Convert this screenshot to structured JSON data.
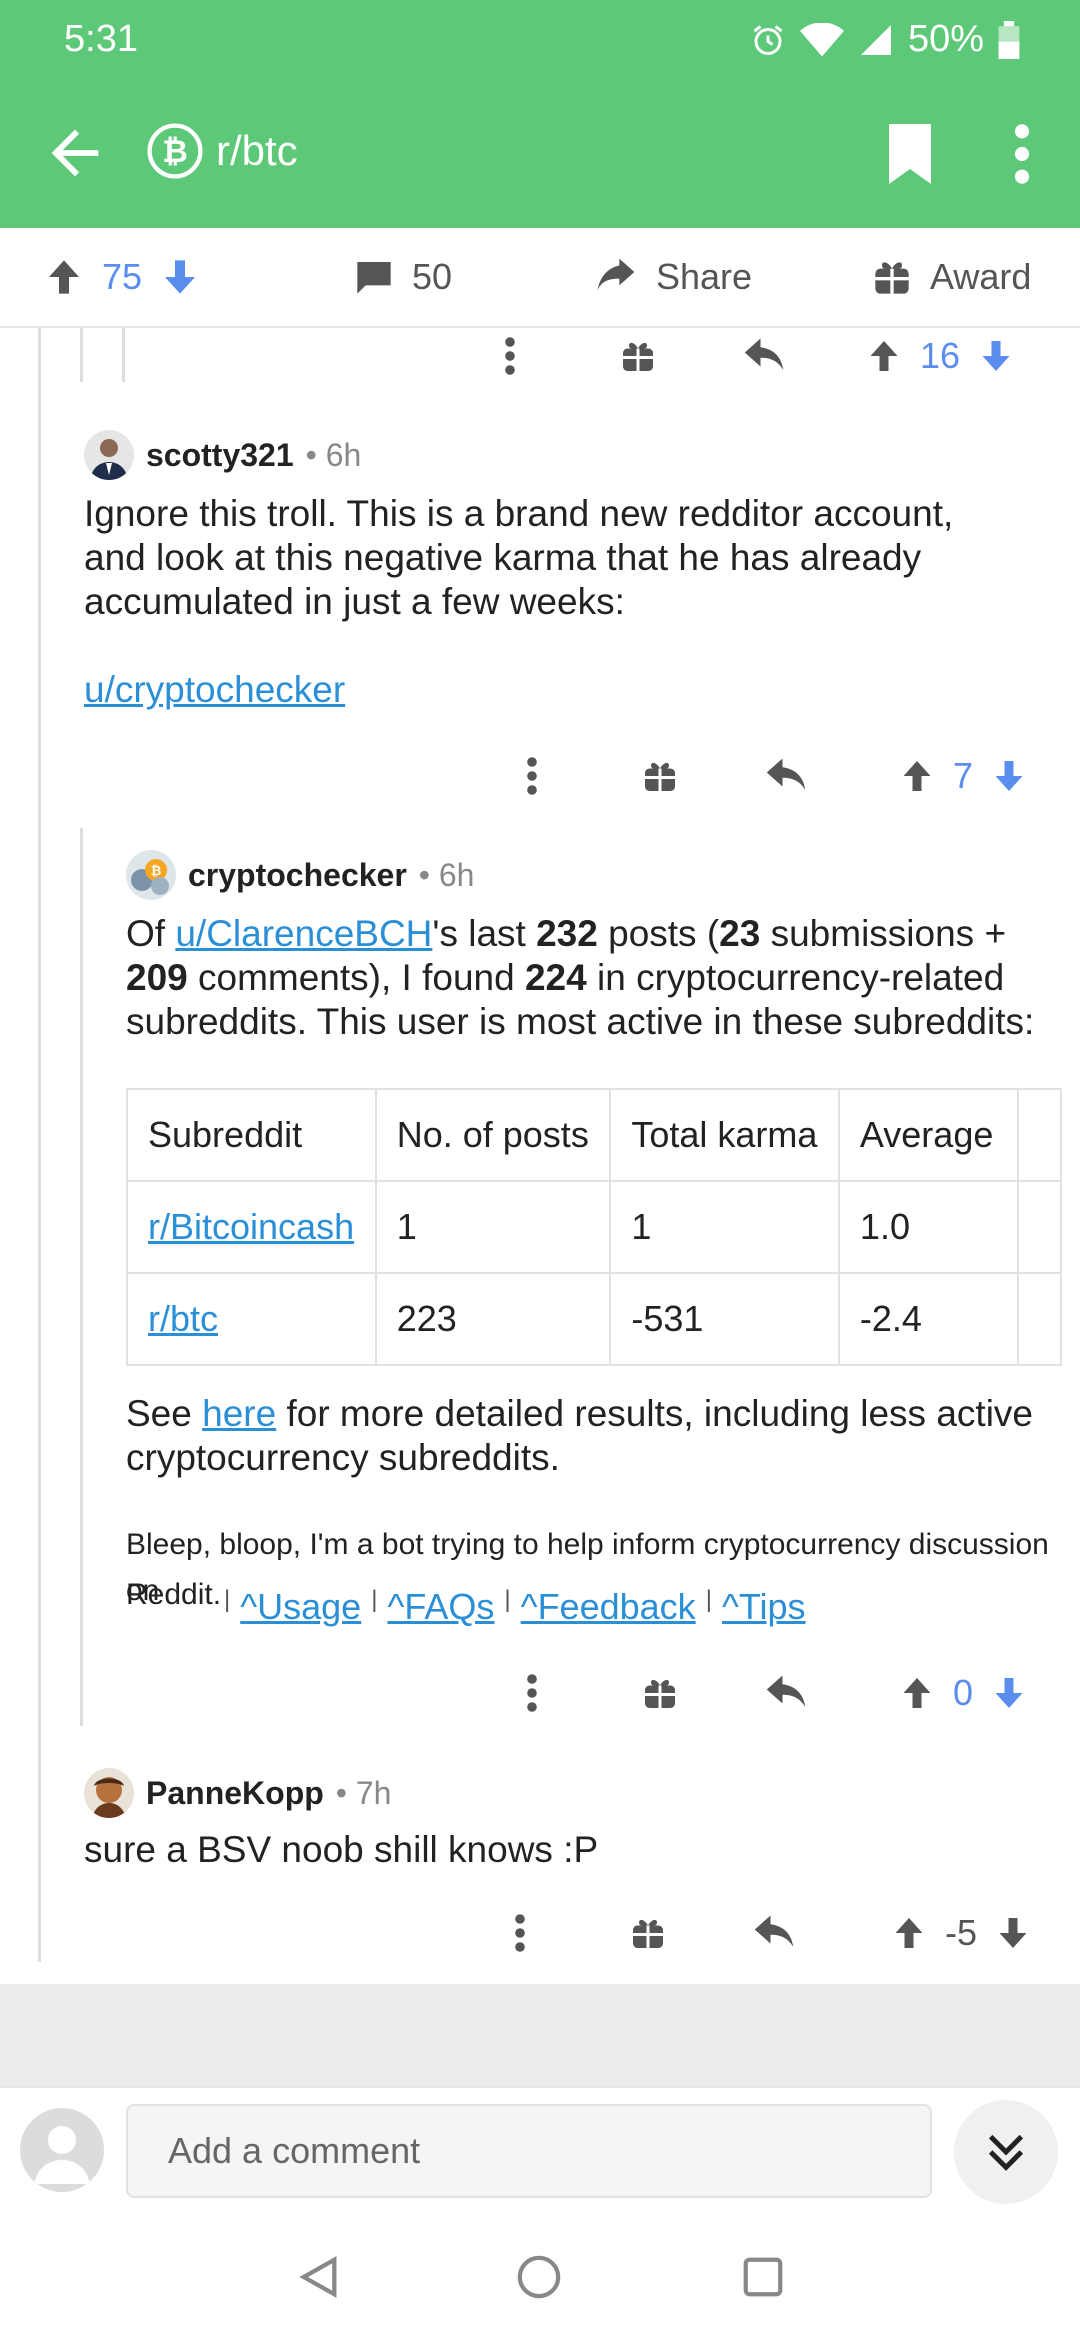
{
  "status": {
    "time": "5:31",
    "battery": "50%"
  },
  "header": {
    "subreddit": "r/btc",
    "icon": "bitcoin-icon"
  },
  "post_bar": {
    "score": "75",
    "comments": "50",
    "share_label": "Share",
    "award_label": "Award"
  },
  "top_action_score": "16",
  "comments": [
    {
      "user": "scotty321",
      "age": "6h",
      "body_lines": [
        "Ignore this troll. This is a brand new redditor account,",
        "and look at this negative karma that he has already",
        "accumulated in just a few weeks:"
      ],
      "link": "u/cryptochecker",
      "score": "7"
    },
    {
      "user": "cryptochecker",
      "age": "6h",
      "intro": {
        "pre": "Of ",
        "link": "u/ClarenceBCH",
        "mid1": "'s last ",
        "n1": "232",
        "mid2": " posts (",
        "n2": "23",
        "mid3": " submissions +",
        "n3": "209",
        "mid4": " comments), I found ",
        "n4": "224",
        "mid5": " in cryptocurrency-related",
        "line3": "subreddits. This user is most active in these subreddits:"
      },
      "table": {
        "headers": [
          "Subreddit",
          "No. of posts",
          "Total karma",
          "Average"
        ],
        "rows": [
          [
            "r/Bitcoincash",
            "1",
            "1",
            "1.0"
          ],
          [
            "r/btc",
            "223",
            "-531",
            "-2.4"
          ]
        ]
      },
      "see": {
        "pre": "See ",
        "link": "here",
        "post": " for more detailed results, including less active",
        "line2": "cryptocurrency subreddits."
      },
      "bot_note_line1": "Bleep, bloop, I'm a bot trying to help inform cryptocurrency discussion on",
      "bot_note_line2": "Reddit.",
      "footer_links": [
        "^Usage",
        "^FAQs",
        "^Feedback",
        "^Tips"
      ],
      "score": "0"
    },
    {
      "user": "PanneKopp",
      "age": "7h",
      "body": "sure a BSV noob shill knows :P",
      "score": "-5"
    }
  ],
  "comment_input": {
    "placeholder": "Add a comment"
  },
  "colors": {
    "brand": "#5dc978",
    "vote_blue": "#5b8def",
    "link": "#2a8fd6"
  }
}
